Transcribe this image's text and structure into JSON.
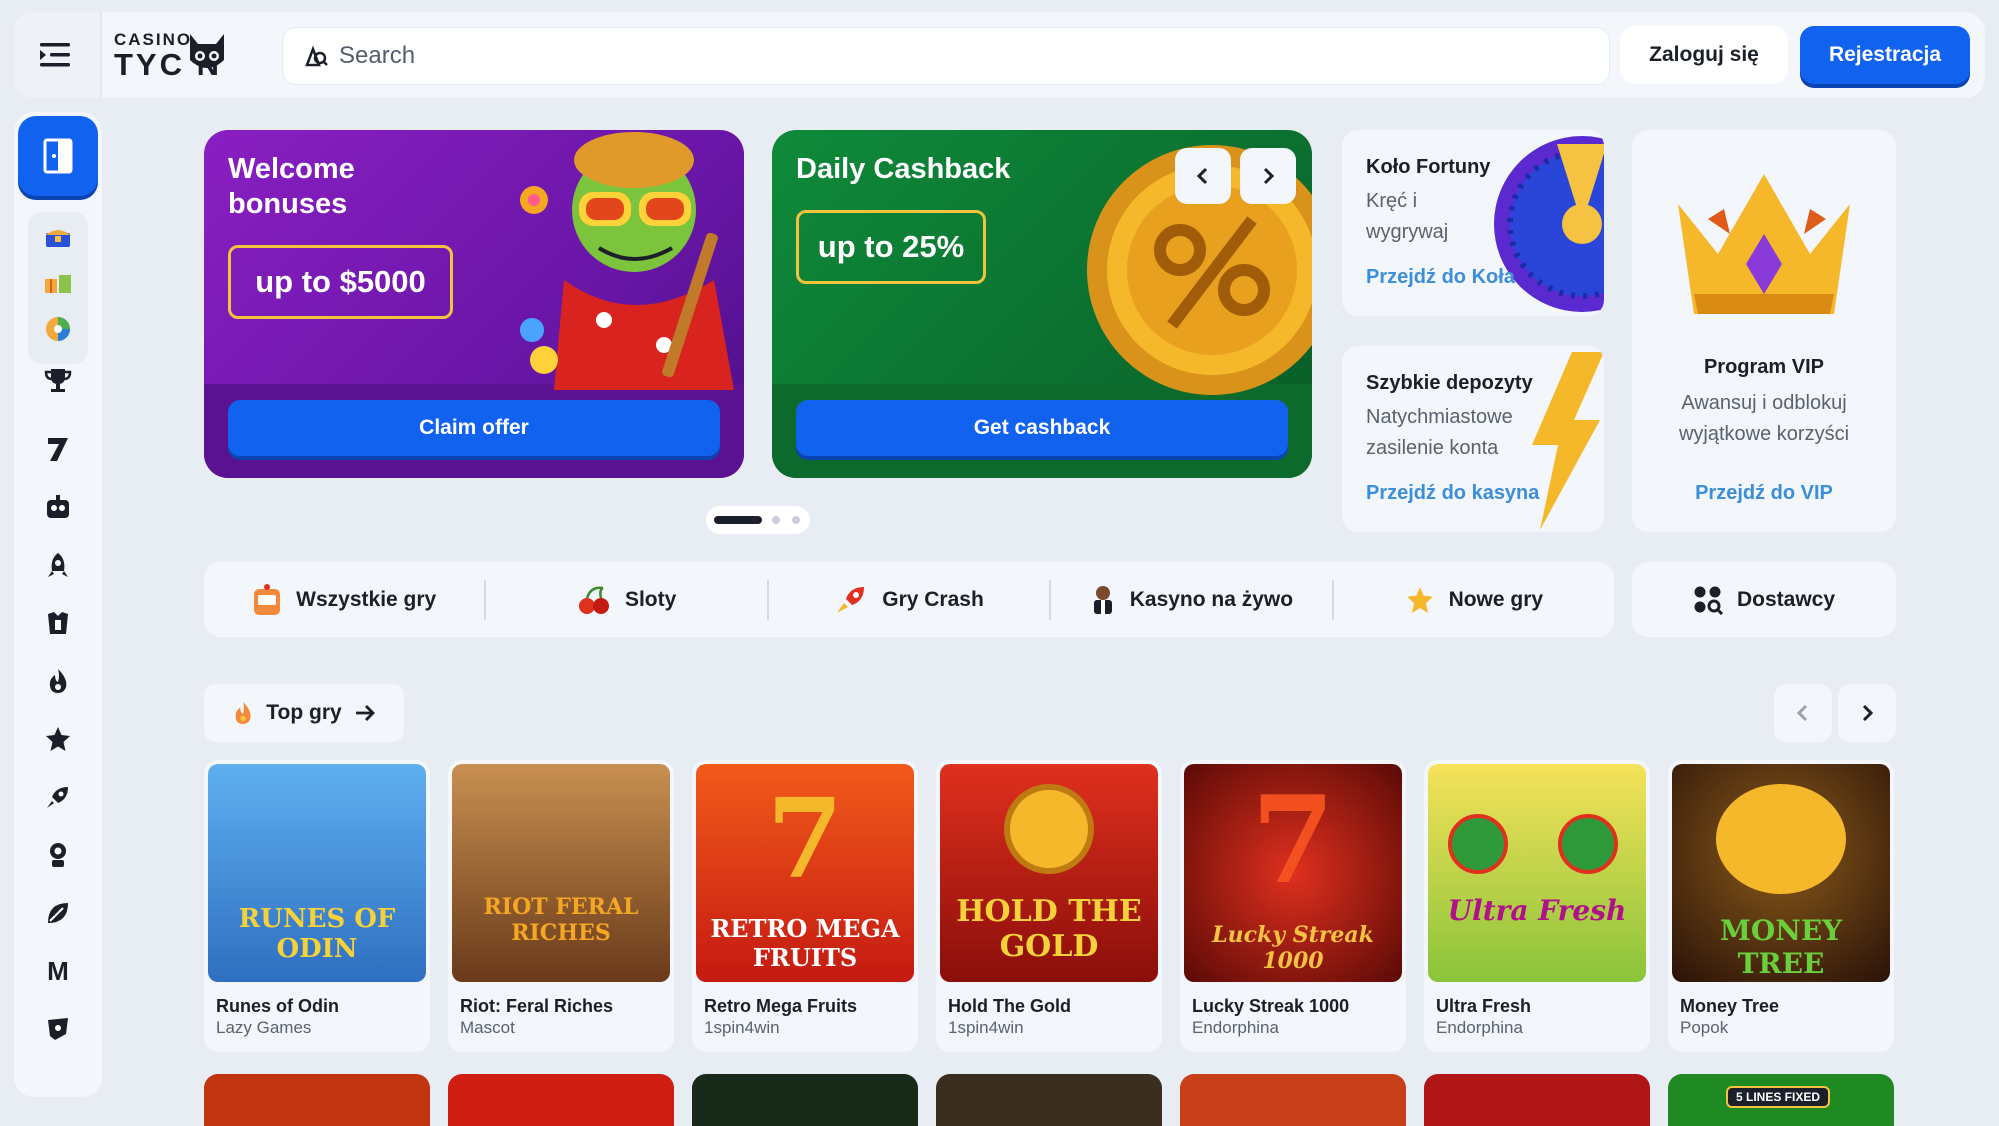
{
  "header": {
    "logo_top": "CASINO",
    "logo_bottom": "TYC  N",
    "search_placeholder": "Search",
    "login_label": "Zaloguj się",
    "register_label": "Rejestracja"
  },
  "sidebar": {
    "items": [
      "lobby-icon",
      "chest-icon",
      "gift-icon",
      "wheel-icon",
      "trophy-icon",
      "seven-icon",
      "robot-icon",
      "rocket-icon",
      "slot-icon",
      "fire-icon",
      "star-icon",
      "crash-rocket-icon",
      "dealer-icon",
      "leaf-icon",
      "provider-m-icon",
      "shield-icon"
    ],
    "m_label": "M"
  },
  "promos": {
    "welcome": {
      "title": "Welcome bonuses",
      "badge": "up to $5000",
      "button": "Claim offer"
    },
    "cashback": {
      "title": "Daily Cashback",
      "badge": "up to 25%",
      "button": "Get cashback"
    }
  },
  "info_cards": {
    "wheel": {
      "title": "Koło Fortuny",
      "text": "Kręć i wygrywaj",
      "link": "Przejdź do Koła"
    },
    "deposit": {
      "title": "Szybkie depozyty",
      "text": "Natychmiastowe zasilenie konta",
      "link": "Przejdź do kasyna"
    },
    "vip": {
      "title": "Program VIP",
      "text": "Awansuj i odblokuj wyjątkowe korzyści",
      "link": "Przejdź do VIP"
    }
  },
  "categories": [
    {
      "label": "Wszystkie gry",
      "icon": "slot-machine-icon"
    },
    {
      "label": "Sloty",
      "icon": "cherry-icon"
    },
    {
      "label": "Gry Crash",
      "icon": "crash-icon"
    },
    {
      "label": "Kasyno na żywo",
      "icon": "dealer-icon"
    },
    {
      "label": "Nowe gry",
      "icon": "star-icon"
    }
  ],
  "providers_label": "Dostawcy",
  "top_games": {
    "label": "Top gry",
    "games": [
      {
        "name": "Runes of Odin",
        "provider": "Lazy Games",
        "art": "RUNES OF ODIN",
        "color": "#2f7ed0"
      },
      {
        "name": "Riot: Feral Riches",
        "provider": "Mascot",
        "art": "RIOT FERAL RICHES",
        "color": "#a8682a"
      },
      {
        "name": "Retro Mega Fruits",
        "provider": "1spin4win",
        "art": "RETRO MEGA FRUITS",
        "color": "#e0301e"
      },
      {
        "name": "Hold The Gold",
        "provider": "1spin4win",
        "art": "HOLD THE GOLD",
        "color": "#c41a12"
      },
      {
        "name": "Lucky Streak 1000",
        "provider": "Endorphina",
        "art": "Lucky Streak 1000",
        "color": "#b5150f"
      },
      {
        "name": "Ultra Fresh",
        "provider": "Endorphina",
        "art": "Ultra Fresh",
        "color": "#6cc04a"
      },
      {
        "name": "Money Tree",
        "provider": "Popok",
        "art": "MONEY TREE",
        "color": "#4a2410"
      }
    ]
  },
  "second_row_colors": [
    "#c0350f",
    "#d01e12",
    "#1a2a1a",
    "#3a2e1e",
    "#c8401a",
    "#b01616",
    "#1f8a22"
  ],
  "second_row_badge": "5 LINES FIXED"
}
